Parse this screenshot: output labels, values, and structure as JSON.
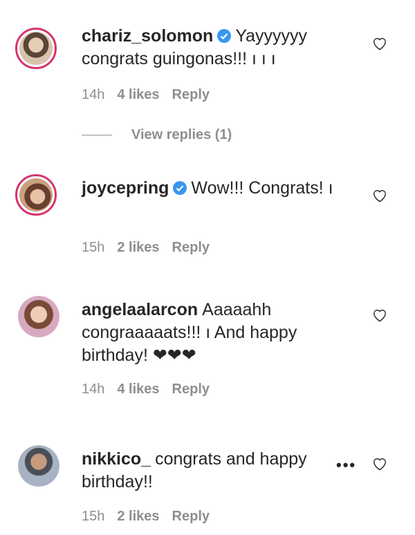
{
  "comments": [
    {
      "username": "chariz_solomon",
      "verified": true,
      "text": "Yayyyyyy congrats guingonas!!! ı ı ı",
      "time": "14h",
      "likes": "4 likes",
      "reply": "Reply"
    },
    {
      "username": "joycepring",
      "verified": true,
      "text": "Wow!!! Congrats! ı",
      "time": "15h",
      "likes": "2 likes",
      "reply": "Reply"
    },
    {
      "username": "angelaalarcon",
      "verified": false,
      "text": "Aaaaahh congraaaaats!!! ı  And happy birthday! ❤❤❤",
      "time": "14h",
      "likes": "4 likes",
      "reply": "Reply"
    },
    {
      "username": "nikkico_",
      "verified": false,
      "text": "congrats and happy birthday!!",
      "time": "15h",
      "likes": "2 likes",
      "reply": "Reply"
    }
  ],
  "view_replies": "View replies (1)",
  "more_icon": "•••",
  "icons": {
    "verified": "verified-badge-icon",
    "like": "heart-outline-icon",
    "more": "ellipsis-icon"
  },
  "colors": {
    "verified": "#3897f0",
    "meta": "#8e8e8e",
    "text": "#262626",
    "story_ring": "#d6336c"
  }
}
